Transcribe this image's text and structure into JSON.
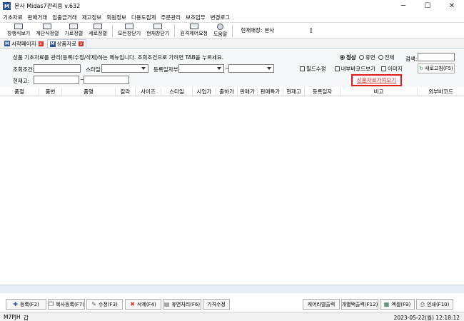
{
  "window": {
    "app_icon": "M",
    "title": "본사 Midas7관리용 v.632",
    "minimize": "─",
    "maximize": "☐",
    "close": "✕"
  },
  "menu": [
    "기초자료",
    "판매거래",
    "입출금거래",
    "재고정보",
    "회원정보",
    "다용도집계",
    "주문관리",
    "보조업무",
    "변경로그"
  ],
  "toolbar": {
    "buttons": [
      "창행식보기",
      "계단식정렬",
      "가로정렬",
      "세로정렬",
      "모든창닫기",
      "현재창닫기",
      "원격제어요청",
      "도움말"
    ],
    "store_label": "현재매장:",
    "store_value": "본사"
  },
  "tabs": [
    {
      "label": "시작페이지",
      "close": "x"
    },
    {
      "label": "상품자료",
      "close": "x"
    }
  ],
  "filter": {
    "description": "상품 기초자료를 관리(등록/수정/삭제)하는 메뉴입니다. 조회조건으로 가려면 TAB을 누르세요.",
    "query_label": "조회조건:",
    "style_label": "스타일:",
    "regdate_label": "등록일자부:",
    "regdate_sep": "~",
    "stock_label": "현재고:",
    "stock_sep": "~",
    "radio_normal": "정상",
    "radio_dormant": "휴면",
    "radio_all": "전체",
    "search_label": "검색:",
    "check_required": "필드수정",
    "check_internal_barcode": "내부바코드보기",
    "check_image": "이미지",
    "refresh_button": "새로고침(F5)",
    "import_link": "상품자료가져오기"
  },
  "grid": {
    "columns": [
      "품절",
      "품번",
      "품명",
      "칼라",
      "사이즈",
      "스타일",
      "사입가",
      "출하가",
      "판매가",
      "판매특가",
      "현재고",
      "등록일자",
      "비고",
      "외부바코드"
    ]
  },
  "buttons": {
    "register": "등록(F2)",
    "copy_register": "복사등록(F7)",
    "edit": "수정(F3)",
    "delete": "삭제(F4)",
    "dormant": "휴면처리(F6)",
    "price_edit": "가격수정",
    "care_label": "케어라벨출력",
    "barcode_print": "개별택출력(F12)",
    "excel": "엑셀(F9)",
    "print": "인쇄(F10)"
  },
  "status": {
    "user": "M7PJH",
    "field": "갑",
    "datetime": "2023-05-22(월) 12:18:12"
  }
}
